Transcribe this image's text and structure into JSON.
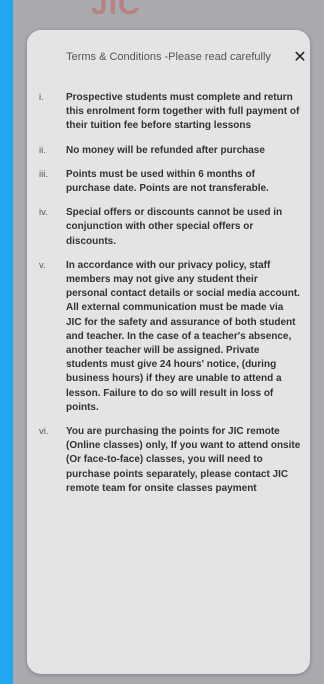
{
  "background": {
    "logo_text": "JIC"
  },
  "modal": {
    "title": "Terms & Conditions -Please read carefully",
    "close_label": "✕",
    "terms": [
      {
        "num": "i.",
        "text": "Prospective students must complete and return this enrolment form together with full payment of their tuition fee before starting lessons"
      },
      {
        "num": "ii.",
        "text": "No money will be refunded after purchase"
      },
      {
        "num": "iii.",
        "text": "Points must be used within 6 months of purchase date. Points are not transferable."
      },
      {
        "num": "iv.",
        "text": "Special offers or discounts cannot be used in conjunction with other special offers or discounts."
      },
      {
        "num": "v.",
        "text": "In accordance with our privacy policy, staff members may not give any student their personal contact details or social media account. All external communication must be made via JIC for the safety and assurance of both student and teacher. In the case of a teacher's absence, another teacher will be assigned. Private students must give 24 hours' notice, (during business hours) if they are unable to attend a lesson. Failure to do so will result in loss of points."
      },
      {
        "num": "vi.",
        "text": "You are purchasing the points for JIC remote (Online classes) only, If you want to attend onsite (Or face-to-face) classes, you will need to purchase points separately, please contact JIC remote team for onsite classes payment"
      }
    ]
  },
  "colors": {
    "accent_bar": "#22a6f2",
    "overlay": "#a9aaad",
    "modal_bg": "#e4e4e6"
  }
}
